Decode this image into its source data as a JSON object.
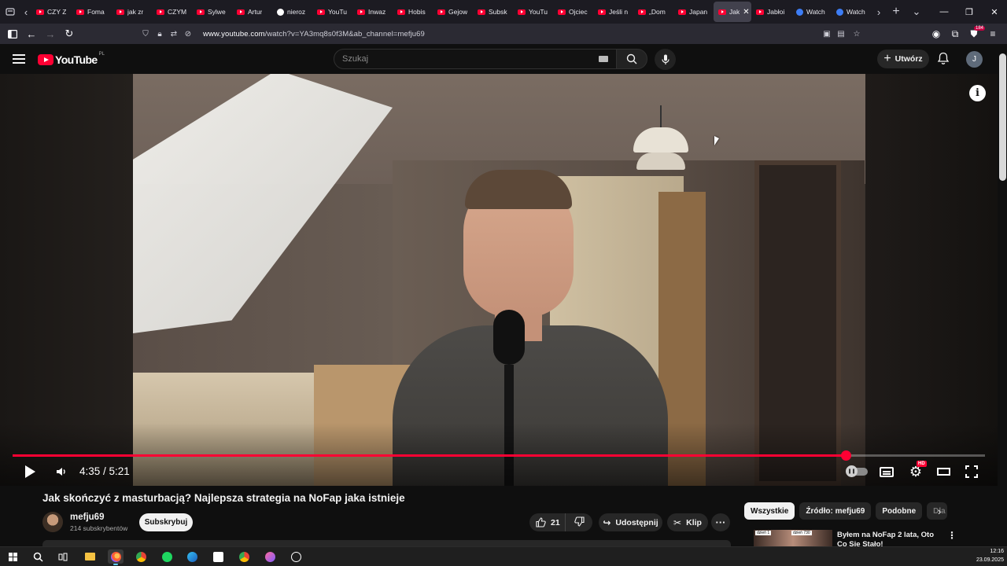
{
  "browser": {
    "tabs": [
      {
        "label": "CZY Z",
        "favicon": "youtube-icon"
      },
      {
        "label": "Foma",
        "favicon": "youtube-icon"
      },
      {
        "label": "jak zr",
        "favicon": "youtube-icon"
      },
      {
        "label": "CZYM",
        "favicon": "youtube-icon"
      },
      {
        "label": "Sylwe",
        "favicon": "youtube-icon"
      },
      {
        "label": "Artur",
        "favicon": "youtube-icon"
      },
      {
        "label": "nieroz",
        "favicon": "google-icon"
      },
      {
        "label": "YouTu",
        "favicon": "youtube-icon"
      },
      {
        "label": "Inwaz",
        "favicon": "youtube-icon"
      },
      {
        "label": "Hobis",
        "favicon": "youtube-icon"
      },
      {
        "label": "Gejow",
        "favicon": "youtube-icon"
      },
      {
        "label": "Subsk",
        "favicon": "youtube-icon"
      },
      {
        "label": "YouTu",
        "favicon": "youtube-icon"
      },
      {
        "label": "Ojciec",
        "favicon": "youtube-icon"
      },
      {
        "label": "Jeśli n",
        "favicon": "youtube-icon"
      },
      {
        "label": "„Dom",
        "favicon": "youtube-icon"
      },
      {
        "label": "Japan",
        "favicon": "youtube-icon"
      },
      {
        "label": "Jak",
        "favicon": "youtube-icon",
        "active": true
      },
      {
        "label": "Jabłoi",
        "favicon": "youtube-icon"
      },
      {
        "label": "Watch",
        "favicon": "watch-icon"
      },
      {
        "label": "Watch",
        "favicon": "watch-icon"
      }
    ],
    "url_host": "www.youtube.com",
    "url_path": "/watch?v=YA3mq8s0f3M&ab_channel=mefju69",
    "extension_badge": "184"
  },
  "youtube": {
    "logo_text": "YouTube",
    "region": "PL",
    "search_placeholder": "Szukaj",
    "create_label": "Utwórz",
    "account_initial": "J"
  },
  "player": {
    "current_time": "4:35",
    "duration": "5:21",
    "time_display": "4:35 / 5:21",
    "progress_fraction": 0.857,
    "hd_label": "HD",
    "info_label": "i"
  },
  "video": {
    "title": "Jak skończyć z masturbacją? Najlepsza strategia na NoFap jaka istnieje",
    "channel_name": "mefju69",
    "subscribers": "214 subskrybentów",
    "subscribe_label": "Subskrybuj",
    "likes": "21",
    "share_label": "Udostępnij",
    "clip_label": "Klip",
    "more_label": "···"
  },
  "sidebar": {
    "chips": [
      {
        "label": "Wszystkie",
        "active": true
      },
      {
        "label": "Źródło: mefju69",
        "active": false
      },
      {
        "label": "Podobne",
        "active": false
      },
      {
        "label": "Dla",
        "active": false
      }
    ],
    "recommendation": {
      "title": "Byłem na NoFap 2 lata, Oto Co Się Stało!",
      "thumb_tag_left": "dzień 1",
      "thumb_tag_right": "dzień 730"
    }
  },
  "taskbar": {
    "time": "12:16",
    "date": "23.09.2025"
  },
  "colors": {
    "youtube_red": "#ff0033",
    "background": "#0f0f0f",
    "chip_bg": "#272727"
  }
}
